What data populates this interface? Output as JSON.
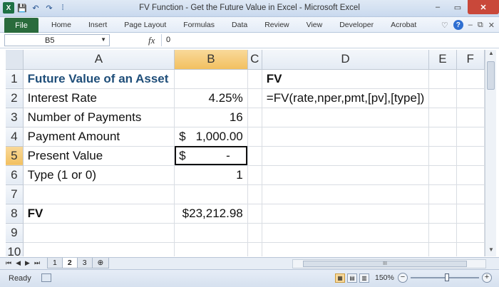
{
  "window": {
    "title": "FV Function - Get the Future Value in Excel - Microsoft Excel",
    "controls": [
      "–",
      "▭",
      "✕"
    ]
  },
  "qat": [
    "X",
    "💾",
    "↶",
    "↷",
    "⁞"
  ],
  "ribbon": {
    "file": "File",
    "tabs": [
      "Home",
      "Insert",
      "Page Layout",
      "Formulas",
      "Data",
      "Review",
      "View",
      "Developer",
      "Acrobat"
    ],
    "right_icons": [
      "♡",
      "?",
      "–",
      "⧉",
      "✕"
    ]
  },
  "formula_bar": {
    "name_box": "B5",
    "fx": "fx",
    "formula": "0"
  },
  "columns": [
    "A",
    "B",
    "C",
    "D",
    "E",
    "F"
  ],
  "rows": [
    {
      "n": "1",
      "a": "Future Value of an Asset",
      "b": "",
      "d": "FV"
    },
    {
      "n": "2",
      "a": "Interest Rate",
      "b": "4.25%",
      "d": "=FV(rate,nper,pmt,[pv],[type])"
    },
    {
      "n": "3",
      "a": "Number of Payments",
      "b": "16",
      "d": ""
    },
    {
      "n": "4",
      "a": "Payment Amount",
      "b_cur": "$",
      "b": "1,000.00",
      "d": ""
    },
    {
      "n": "5",
      "a": "Present Value",
      "b_cur": "$",
      "b": "-",
      "d": ""
    },
    {
      "n": "6",
      "a": "Type (1 or 0)",
      "b": "1",
      "d": ""
    },
    {
      "n": "7",
      "a": "",
      "b": "",
      "d": ""
    },
    {
      "n": "8",
      "a": "FV",
      "b": "$23,212.98",
      "d": ""
    },
    {
      "n": "9",
      "a": "",
      "b": "",
      "d": ""
    },
    {
      "n": "10",
      "a": "",
      "b": "",
      "d": ""
    }
  ],
  "sheet_bar": {
    "nav": [
      "⏮",
      "◀",
      "▶",
      "⏭"
    ],
    "tabs": [
      "1",
      "2",
      "3"
    ],
    "active_tab": "2",
    "scroll_mark": "III"
  },
  "status": {
    "ready": "Ready",
    "zoom": "150%",
    "zoom_minus": "−",
    "zoom_plus": "+"
  }
}
